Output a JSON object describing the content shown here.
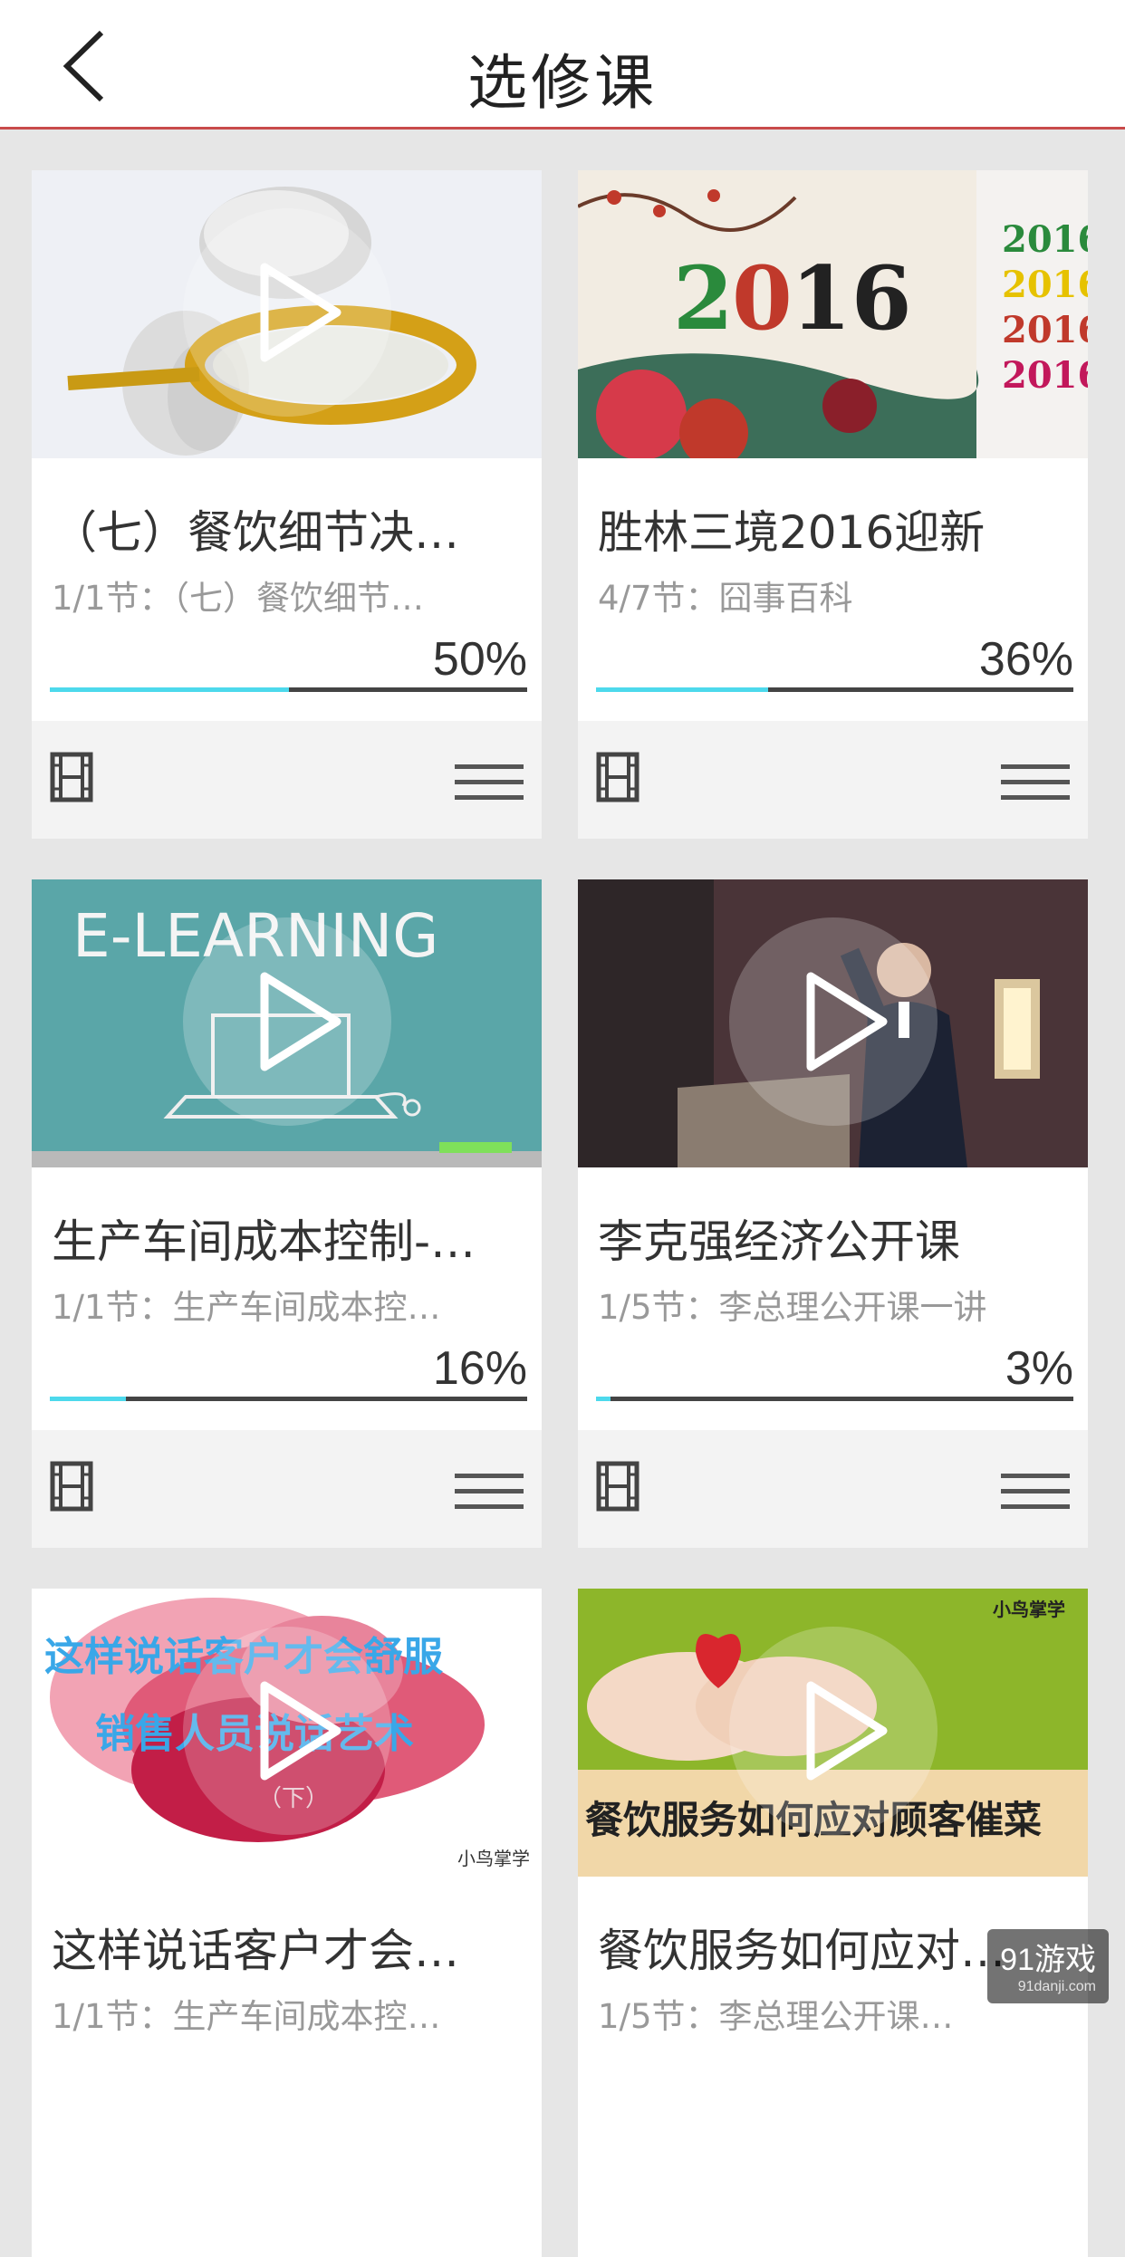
{
  "header": {
    "title": "选修课",
    "back_icon": "chevron-left-icon"
  },
  "colors": {
    "accent_line": "#c94a4a",
    "progress_fill": "#4dd9ec",
    "progress_track": "#444444"
  },
  "courses": [
    {
      "title": "（七）餐饮细节决…",
      "subtitle": "1/1节：（七）餐饮细节…",
      "percent": "50%",
      "progress": 0.5,
      "thumb": "magnifier-figure"
    },
    {
      "title": "胜林三境2016迎新",
      "subtitle": "4/7节：囧事百科",
      "percent": "36%",
      "progress": 0.36,
      "thumb": "new-year-2016"
    },
    {
      "title": "生产车间成本控制-…",
      "subtitle": "1/1节：生产车间成本控…",
      "percent": "16%",
      "progress": 0.16,
      "thumb": "e-learning",
      "thumb_text": "E-LEARNING"
    },
    {
      "title": "李克强经济公开课",
      "subtitle": "1/5节：李总理公开课一讲",
      "percent": "3%",
      "progress": 0.03,
      "thumb": "speaker-podium"
    },
    {
      "title": "这样说话客户才会…",
      "subtitle": "1/1节：生产车间成本控…",
      "percent": "",
      "progress": 0,
      "thumb": "ink-red",
      "thumb_text": "这样说话客户才会舒服",
      "thumb_text2": "销售人员说话艺术",
      "thumb_text3": "（下）",
      "thumb_brand": "小鸟掌学"
    },
    {
      "title": "餐饮服务如何应对…",
      "subtitle": "1/5节：李总理公开课…",
      "percent": "",
      "progress": 0,
      "thumb": "hands-heart",
      "thumb_text": "餐饮服务如何应对顾客催菜",
      "thumb_brand": "小鸟掌学"
    }
  ],
  "watermark": {
    "text": "91游戏",
    "sub": "91danji.com"
  }
}
